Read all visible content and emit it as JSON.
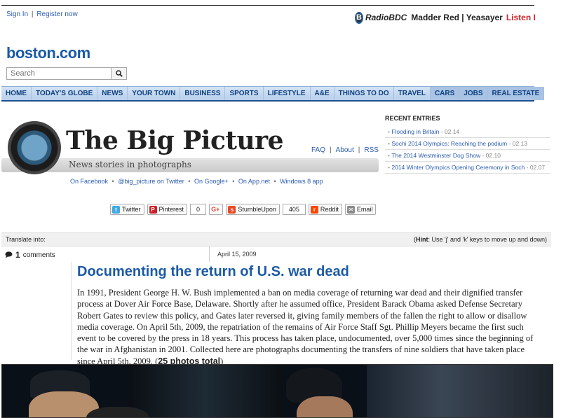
{
  "top": {
    "sign_in": "Sign In",
    "separator": "|",
    "register": "Register now"
  },
  "radio": {
    "logo_letter": "B",
    "name": "RadioBDC",
    "now_playing": "Madder Red | Yeasayer",
    "listen": "Listen Liv"
  },
  "site": {
    "logo": "boston.com",
    "search_placeholder": "Search"
  },
  "nav": {
    "items": [
      "HOME",
      "TODAY'S GLOBE",
      "NEWS",
      "YOUR TOWN",
      "BUSINESS",
      "SPORTS",
      "LIFESTYLE",
      "A&E",
      "THINGS TO DO",
      "TRAVEL",
      "CARS",
      "JOBS",
      "REAL ESTATE"
    ]
  },
  "blog": {
    "title": "The Big Picture",
    "subtitle": "News stories in photographs",
    "faq": "FAQ",
    "about": "About",
    "rss": "RSS",
    "social": [
      "On Facebook",
      "@big_picture on Twitter",
      "On Google+",
      "On App.net",
      "Windows 8 app"
    ],
    "bullet_sep": "•"
  },
  "recent": {
    "heading": "RECENT ENTRIES",
    "entries": [
      {
        "title": "Flooding in Britain",
        "date": " - 02.14"
      },
      {
        "title": "Sochi 2014 Olympics: Reaching the podium",
        "date": " - 02.13"
      },
      {
        "title": "The 2014 Westminster Dog Show",
        "date": " - 02.10"
      },
      {
        "title": "2014 Winter Olympics Opening Ceremony in Soch",
        "date": " - 02.07"
      }
    ]
  },
  "share": {
    "twitter": "Twitter",
    "pinterest": "Pinterest",
    "pinterest_count": "0",
    "gplus": "G+",
    "stumble": "StumbleUpon",
    "stumble_count": "405",
    "reddit": "Reddit",
    "email": "Email"
  },
  "translate": {
    "label": "Translate into:",
    "hint_open": "(",
    "hint_label": "Hint",
    "hint_text": ": Use 'j' and 'k' keys to move up and down)"
  },
  "post": {
    "comment_count": "1",
    "comments_label": "comments",
    "date": "April 15, 2009",
    "headline": "Documenting the return of U.S. war dead",
    "body": "In 1991, President George H. W. Bush implemented a ban on media coverage of returning war dead and their dignified transfer process at Dover Air Force Base, Delaware. Shortly after he assumed office, President Barack Obama asked Defense Secretary Robert Gates to review this policy, and Gates later reversed it, giving family members of the fallen the right to allow or disallow media coverage. On April 5th, 2009, the repatriation of the remains of Air Force Staff Sgt. Phillip Meyers became the first such event to be covered by the press in 18 years. This process has taken place, undocumented, over 5,000 times since the beginning of the war in Afghanistan in 2001. Collected here are photographs documenting the transfers of nine soldiers that have taken place since April 5th, 2009. (",
    "photos_total": "25 photos total",
    "body_close": ")"
  },
  "colors": {
    "link": "#2b5cb1",
    "headline": "#1c5aa5",
    "nav_bg": "#c7dbf1",
    "listen": "#d7242b"
  }
}
